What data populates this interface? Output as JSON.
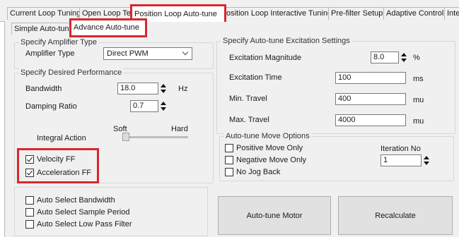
{
  "top_tabs": [
    {
      "label": "Current Loop Tuning"
    },
    {
      "label": "Open Loop Te"
    },
    {
      "label": "Position Loop Auto-tune"
    },
    {
      "label": "osition Loop Interactive Tuning"
    },
    {
      "label": "Pre-filter Setup"
    },
    {
      "label": "Adaptive Control"
    },
    {
      "label": "Inte"
    }
  ],
  "sub_tabs": [
    {
      "label": "Simple Auto-tune"
    },
    {
      "label": "Advance Auto-tune"
    }
  ],
  "amplifier": {
    "legend": "Specify Amplifier Type",
    "type_label": "Amplifier Type",
    "type_value": "Direct PWM"
  },
  "performance": {
    "legend": "Specify Desired Performance",
    "bandwidth_label": "Bandwidth",
    "bandwidth_value": "18.0",
    "bandwidth_unit": "Hz",
    "damping_label": "Damping Ratio",
    "damping_value": "0.7",
    "integral_label": "Integral Action",
    "soft_label": "Soft",
    "hard_label": "Hard",
    "integral_level": 0.0,
    "velocity_ff_label": "Velocity FF",
    "velocity_ff_checked": true,
    "acceleration_ff_label": "Acceleration FF",
    "acceleration_ff_checked": true
  },
  "auto_select": {
    "bandwidth_label": "Auto Select Bandwidth",
    "sample_period_label": "Auto Select Sample Period",
    "low_pass_label": "Auto Select Low Pass Filter"
  },
  "excitation": {
    "legend": "Specify Auto-tune Excitation Settings",
    "magnitude_label": "Excitation Magnitude",
    "magnitude_value": "8.0",
    "magnitude_unit": "%",
    "time_label": "Excitation Time",
    "time_value": "100",
    "time_unit": "ms",
    "min_travel_label": "Min. Travel",
    "min_travel_value": "400",
    "min_travel_unit": "mu",
    "max_travel_label": "Max. Travel",
    "max_travel_value": "4000",
    "max_travel_unit": "mu"
  },
  "move_options": {
    "legend": "Auto-tune Move Options",
    "positive_label": "Positive Move Only",
    "negative_label": "Negative Move Only",
    "nojog_label": "No Jog Back",
    "iteration_label": "Iteration No",
    "iteration_value": "1"
  },
  "buttons": {
    "autotune_label": "Auto-tune Motor",
    "recalc_label": "Recalculate"
  },
  "colors": {
    "highlight": "#d9262e",
    "panel_bg": "#f0f0f0"
  }
}
